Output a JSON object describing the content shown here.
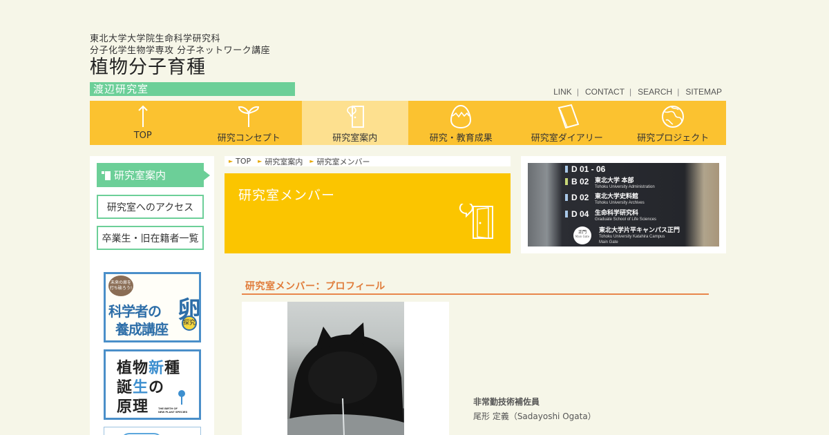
{
  "header": {
    "university_line1": "東北大学大学院生命科学研究科",
    "university_line2": "分子化学生物学専攻 分子ネットワーク講座",
    "lab_title": "植物分子育種",
    "lab_subtitle": "渡辺研究室"
  },
  "utility_nav": [
    {
      "label": "LINK",
      "separator": "|"
    },
    {
      "label": "CONTACT",
      "separator": "|"
    },
    {
      "label": "SEARCH",
      "separator": "|"
    },
    {
      "label": "SITEMAP",
      "separator": ""
    }
  ],
  "global_nav": [
    {
      "label": "TOP",
      "icon": "arrow-up-icon"
    },
    {
      "label": "研究コンセプト",
      "icon": "sprout-icon"
    },
    {
      "label": "研究室案内",
      "icon": "door-icon",
      "active": true
    },
    {
      "label": "研究・教育成果",
      "icon": "egg-icon"
    },
    {
      "label": "研究室ダイアリー",
      "icon": "notebook-icon"
    },
    {
      "label": "研究プロジェクト",
      "icon": "globe-icon"
    }
  ],
  "sidebar": {
    "active_label": "研究室案内",
    "links": [
      "研究室へのアクセス",
      "卒業生・旧在籍者一覧"
    ],
    "banners": {
      "banner1_top": "未来の扉を",
      "banner1_top2": "打ち破ろう!",
      "banner1_main": "科学者の",
      "banner1_big": "卵",
      "banner1_main2": "養成講座",
      "banner1_badge": "探究",
      "banner2_line1a": "植物",
      "banner2_line1b": "新",
      "banner2_line1c": "種",
      "banner2_line2a": "誕",
      "banner2_line2b": "生",
      "banner2_line2c": "の",
      "banner2_line3": "原理",
      "banner2_en1": "THE BIRTH OF",
      "banner2_en2": "NEW PLANT SPECIES"
    }
  },
  "breadcrumb": [
    "TOP",
    "研究室案内",
    "研究室メンバー"
  ],
  "page_title": "研究室メンバー",
  "sign": {
    "rows": [
      {
        "code": "D 01 - 06",
        "ja": "",
        "en": "",
        "tag_color": "#a8c8e8"
      },
      {
        "code": "B 02",
        "ja": "東北大学 本部",
        "en": "Tohoku University Administration",
        "tag_color": "#c8d878"
      },
      {
        "code": "D 02",
        "ja": "東北大学史料館",
        "en": "Tohoku University Archives",
        "tag_color": "#a8c8e8"
      },
      {
        "code": "D 04",
        "ja": "生命科学研究科",
        "en": "Graduate School of Life Sciences",
        "tag_color": "#a8c8e8"
      },
      {
        "code": "",
        "ja": "東北大学片平キャンパス正門",
        "en": "Tohoku University Katahira Campus",
        "en2": "Main Gate",
        "tag_color": "#ffffff"
      }
    ],
    "gate_ja": "正門",
    "gate_en": "Main Gate"
  },
  "section_heading": "研究室メンバー：プロフィール",
  "profile": {
    "role": "非常勤技術補佐員",
    "name": "尾形 定義（Sadayoshi Ogata）"
  },
  "colors": {
    "nav_yellow": "#fbc230",
    "nav_active": "#fde08f",
    "lab_green": "#6ccf98",
    "page_header_yellow": "#fbc500",
    "heading_orange": "#e07b39",
    "banner_blue": "#4a8fc9"
  }
}
